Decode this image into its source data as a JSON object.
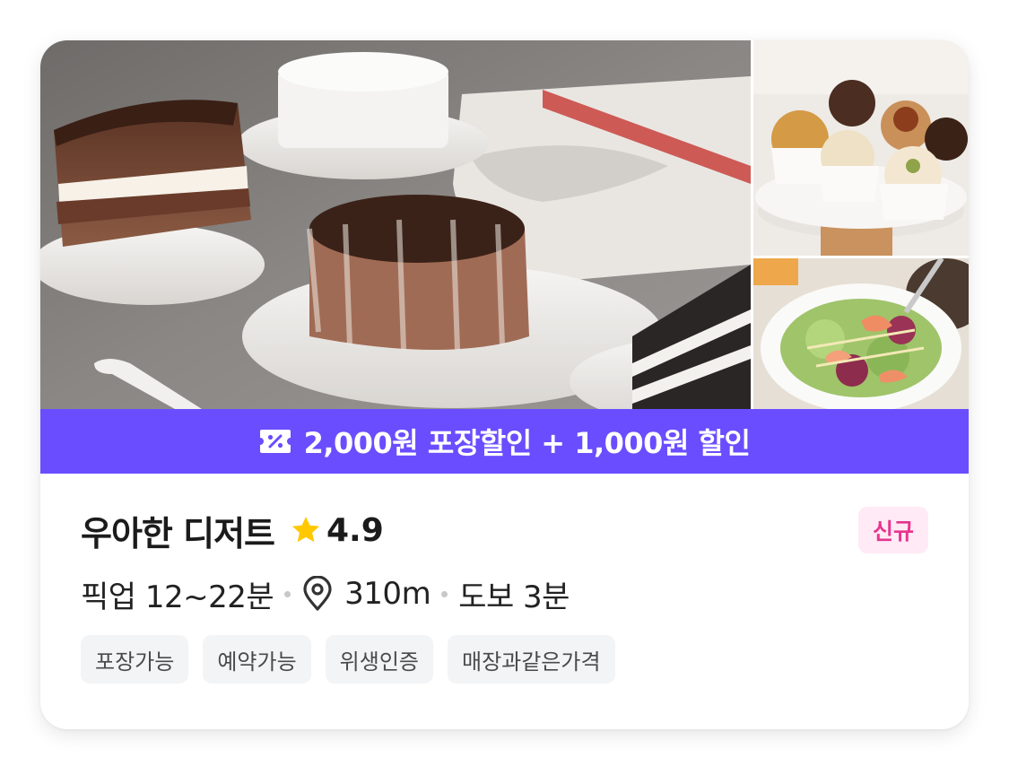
{
  "photos": {
    "main_icon": "cake-photo",
    "top_icon": "muffin-photo",
    "bottom_icon": "salad-photo"
  },
  "promo": {
    "text": "2,000원 포장할인 + 1,000원 할인",
    "icon": "coupon-icon",
    "background": "#6a4dff"
  },
  "store": {
    "name": "우아한 디저트",
    "rating": "4.9",
    "rating_icon": "star-icon",
    "star_color": "#ffc800"
  },
  "badge": {
    "label": "신규",
    "background": "#ffeaf5",
    "color": "#e6358f"
  },
  "meta": {
    "pickup": "픽업 12~22분",
    "distance_icon": "location-pin-icon",
    "distance": "310m",
    "walk": "도보 3분"
  },
  "tags": [
    "포장가능",
    "예약가능",
    "위생인증",
    "매장과같은가격"
  ]
}
